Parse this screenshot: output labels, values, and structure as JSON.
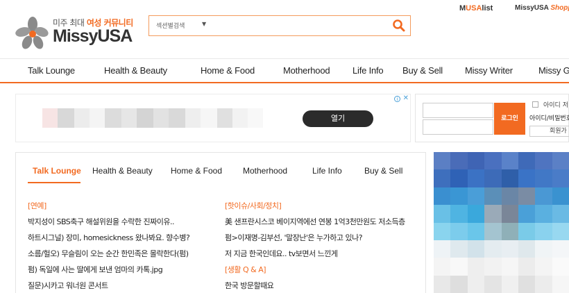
{
  "header": {
    "logo_tagline_prefix": "미주 최대",
    "logo_tagline_highlight": "여성 커뮤니티",
    "logo_name": "MissyUSA",
    "search_select": "섹션별검색",
    "search_placeholder": "",
    "top_link_musalist_prefix": "M",
    "top_link_musalist_accent": "USA",
    "top_link_musalist_suffix": "list",
    "top_link_shopping_prefix": "MissyUSA ",
    "top_link_shopping_accent": "Shoppi"
  },
  "nav": {
    "items": [
      "Talk Lounge",
      "Health & Beauty",
      "Home & Food",
      "Motherhood",
      "Life Info",
      "Buy & Sell",
      "Missy Writer",
      "Missy Ga"
    ]
  },
  "ad": {
    "open_label": "열기"
  },
  "login": {
    "button_label": "로그인",
    "save_id_label": "아이디 저",
    "find_label": "아이디/비밀번호",
    "join_label": "회원가"
  },
  "content": {
    "tabs": [
      "Talk Lounge",
      "Health & Beauty",
      "Home & Food",
      "Motherhood",
      "Life Info",
      "Buy & Sell"
    ],
    "left_column": [
      "[연예]",
      "박지성이 SBS축구 해설위원을 수락한 진짜이유..",
      "하트시그널) 장미, homesickness 왔나봐요. 향수병?",
      "소름/헐오) 무슬림이 오는 순간 한민족은 몰락한다(펌)",
      "펌) 독일에 사는 딸에게 보낸 엄마의 카톡.jpg",
      "질문)시카고 워너원 콘서트"
    ],
    "right_column": [
      "[핫이슈/사회/정치]",
      "美 샌프란시스코 베이지역에선 연봉 1억3천만원도 저소득층",
      "펌>이재명-김부선, '말장난'은 누가하고 있나?",
      "저 지금 한국인데요.. tv보면서 느낀게",
      "[생활 Q & A]",
      "한국 방문할때요"
    ]
  }
}
